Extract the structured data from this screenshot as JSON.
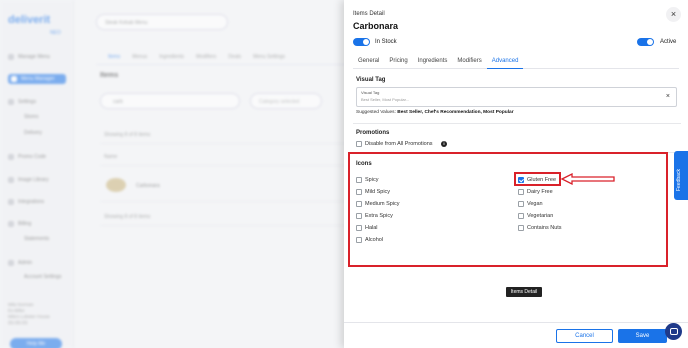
{
  "app": {
    "logo": "deliverit",
    "logo_sub": "NEO"
  },
  "background": {
    "sidebar": [
      {
        "label": "Manage Menu",
        "active": false
      },
      {
        "label": "Menu Manager",
        "active": true
      },
      {
        "label": "Settings",
        "active": false
      },
      {
        "label": "Stores",
        "active": false,
        "sub": true
      },
      {
        "label": "Delivery",
        "active": false,
        "sub": true
      },
      {
        "label": "Promo Code",
        "active": false
      },
      {
        "label": "Image Library",
        "active": false
      },
      {
        "label": "Integrations",
        "active": false
      },
      {
        "label": "Billing",
        "active": false
      },
      {
        "label": "Statements",
        "active": false,
        "sub": true
      },
      {
        "label": "Admin",
        "active": false
      },
      {
        "label": "Account Settings",
        "active": false,
        "sub": true
      }
    ],
    "user_lines": [
      "Mila Norman",
      "Ex-Biller",
      "Mila's Lobster House",
      "(5)-(8)-(0)"
    ],
    "help_label": "Help Me",
    "menu_select": "Steak Kebab Menu",
    "tabs": [
      "Items",
      "Menus",
      "Ingredients",
      "Modifiers",
      "Deals",
      "Menu Settings"
    ],
    "items_heading": "Items",
    "search_value": "carb",
    "filter_placeholder": "Category selected",
    "rows": [
      "Showing 8 of 8 items",
      "Name",
      "",
      "Showing 8 of 8 items"
    ],
    "food_name": "Carbonara"
  },
  "panel": {
    "header_label": "Items Detail",
    "close_glyph": "×",
    "title": "Carbonara",
    "in_stock_label": "In Stock",
    "active_label": "Active",
    "tabs": [
      {
        "label": "General",
        "active": false
      },
      {
        "label": "Pricing",
        "active": false
      },
      {
        "label": "Ingredients",
        "active": false
      },
      {
        "label": "Modifiers",
        "active": false
      },
      {
        "label": "Advanced",
        "active": true
      }
    ],
    "visual_tag": {
      "section_title": "Visual Tag",
      "field_label": "Visual Tag",
      "placeholder": "Best Seller, Most Popular...",
      "clear_glyph": "×",
      "suggested_prefix": "Suggested Values:",
      "suggested_values": "Best Seller, Chef's Recommendation, Most Popular"
    },
    "promotions": {
      "section_title": "Promotions",
      "disable_label": "Disable from All Promotions",
      "info_glyph": "i"
    },
    "icons": {
      "section_title": "Icons",
      "left": [
        {
          "label": "Spicy",
          "checked": false
        },
        {
          "label": "Mild Spicy",
          "checked": false
        },
        {
          "label": "Medium Spicy",
          "checked": false
        },
        {
          "label": "Extra Spicy",
          "checked": false
        },
        {
          "label": "Halal",
          "checked": false
        },
        {
          "label": "Alcohol",
          "checked": false
        }
      ],
      "right": [
        {
          "label": "Gluten Free",
          "checked": true
        },
        {
          "label": "Dairy Free",
          "checked": false
        },
        {
          "label": "Vegan",
          "checked": false
        },
        {
          "label": "Vegetarian",
          "checked": false
        },
        {
          "label": "Contains Nuts",
          "checked": false
        }
      ]
    },
    "tooltip": "Items Detail",
    "cancel_label": "Cancel",
    "save_label": "Save"
  },
  "feedback_label": "Feedback",
  "colors": {
    "accent": "#1a73e8",
    "highlight": "#d9212a"
  }
}
